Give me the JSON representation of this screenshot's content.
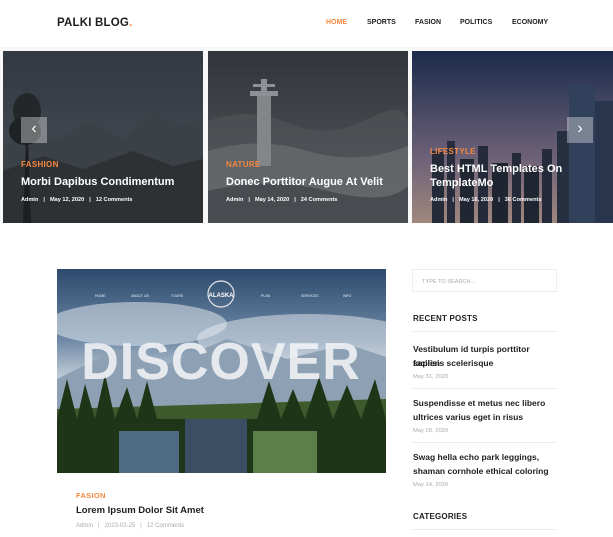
{
  "header": {
    "logo": "PALKI BLOG",
    "logo_dot": ".",
    "nav": [
      "HOME",
      "SPORTS",
      "FASION",
      "POLITICS",
      "ECONOMY"
    ]
  },
  "slider": {
    "slides": [
      {
        "category": "FASHION",
        "title": "Morbi Dapibus Condimentum",
        "author": "Admin",
        "date": "May 12, 2020",
        "comments": "12 Comments"
      },
      {
        "category": "NATURE",
        "title": "Donec Porttitor Augue At Velit",
        "author": "Admin",
        "date": "May 14, 2020",
        "comments": "24 Comments"
      },
      {
        "category": "LIFESTYLE",
        "title_line1": "Best HTML Templates On",
        "title_line2": "TemplateMo",
        "author": "Admin",
        "date": "May 16, 2020",
        "comments": "36 Comments"
      }
    ],
    "prev_icon": "‹",
    "next_icon": "›"
  },
  "post": {
    "image_text": "DISCOVER",
    "image_logo": "ALASKA",
    "image_menu": [
      "HOME",
      "ABOUT US",
      "TOURS",
      "PLAN",
      "SERVICES",
      "INFO"
    ],
    "category": "FASION",
    "title": "Lorem Ipsum Dolor Sit Amet",
    "author": "Admin",
    "date": "2023-02-25",
    "comments": "12 Comments"
  },
  "sidebar": {
    "search_placeholder": "TYPE TO SEARCH...",
    "recent_heading": "RECENT POSTS",
    "recent_posts": [
      {
        "line1": "Vestibulum id turpis porttitor sapien",
        "line2": "facilisis scelerisque",
        "date": "May 31, 2020"
      },
      {
        "line1": "Suspendisse et metus nec libero",
        "line2": "ultrices varius eget in risus",
        "date": "May 28, 2020"
      },
      {
        "line1": "Swag hella echo park leggings,",
        "line2": "shaman cornhole ethical coloring",
        "date": "May 14, 2020"
      }
    ],
    "categories_heading": "CATEGORIES"
  },
  "colors": {
    "accent": "#f48840",
    "text": "#1e1e1e",
    "muted": "#aaaaaa"
  }
}
